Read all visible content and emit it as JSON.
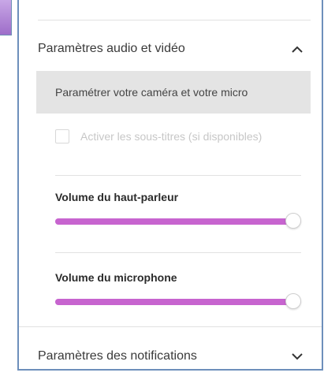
{
  "panel": {
    "audio_video": {
      "title": "Paramètres audio et vidéo",
      "expanded": true,
      "chevron_icon": "chevron-up-icon",
      "camera_mic_link": "Paramétrer votre caméra et votre micro",
      "subtitles": {
        "label": "Activer les sous-titres (si disponibles)",
        "checked": false,
        "disabled": true
      },
      "speaker": {
        "label": "Volume du haut-parleur",
        "value_fraction": 1.0
      },
      "microphone": {
        "label": "Volume du microphone",
        "value_fraction": 1.0
      }
    },
    "notifications": {
      "title": "Paramètres des notifications",
      "expanded": false,
      "chevron_icon": "chevron-down-icon"
    }
  },
  "colors": {
    "slider_fill": "#c764cf",
    "slider_track": "#e8d3ec",
    "highlight_row": "#e4e4e4",
    "panel_border": "#6d8fbb"
  }
}
